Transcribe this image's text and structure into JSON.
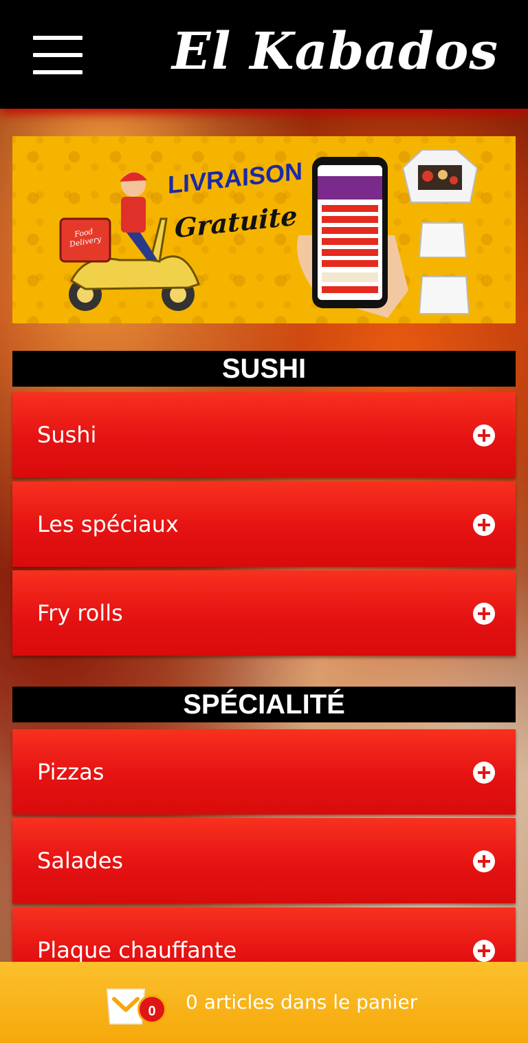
{
  "header": {
    "brand": "El Kabados"
  },
  "banner": {
    "headline": "LIVRAISON",
    "subline": "Gratuite",
    "scooter_badge": "Food Delivery"
  },
  "sections": [
    {
      "title": "SUSHI",
      "items": [
        {
          "label": "Sushi"
        },
        {
          "label": "Les spéciaux"
        },
        {
          "label": "Fry rolls"
        }
      ]
    },
    {
      "title": "SPÉCIALITÉ",
      "items": [
        {
          "label": "Pizzas"
        },
        {
          "label": "Salades"
        },
        {
          "label": "Plaque chauffante"
        }
      ]
    }
  ],
  "cart": {
    "count": "0",
    "text": "0 articles dans le panier"
  },
  "colors": {
    "header_bg": "#000000",
    "category_red": "#e51212",
    "cart_bar": "#f6a80a",
    "banner_yellow": "#f5b400"
  }
}
